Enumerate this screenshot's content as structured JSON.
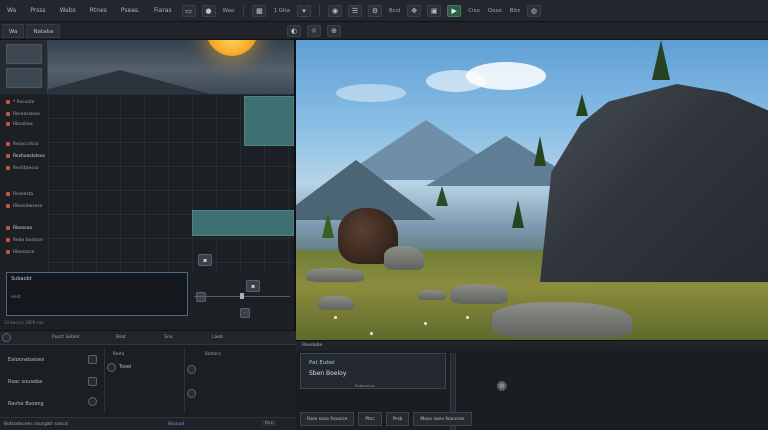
{
  "menubar": {
    "items": [
      "Wa",
      "Prsss",
      "Wabs",
      "Rtnes",
      "Pseas.",
      "Fiaras"
    ],
    "tb_label_1": "Wao",
    "tb_label_2": "1 Gtia",
    "tb_label_3": "Bcsl",
    "tb_label_4": "Ciso",
    "tb_label_5": "Ooso",
    "tb_label_6": "Bitz"
  },
  "toolbar2": {
    "tab1": "Wa",
    "tab2": "Nataba"
  },
  "left_panel": {
    "rows": [
      {
        "label": "* Rscusto",
        "hl": false
      },
      {
        "label": "Rbreaslasse",
        "hl": false
      },
      {
        "label": "Rbsaloac",
        "hl": false
      },
      {
        "label": "Relaccrlsco",
        "hl": false
      },
      {
        "label": "Reshoeslotsos",
        "hl": true
      },
      {
        "label": "Reshtaesso",
        "hl": false
      },
      {
        "label": "Reskesta",
        "hl": false
      },
      {
        "label": "Rbesotwseso",
        "hl": false
      },
      {
        "label": "Rbessoa",
        "hl": true
      },
      {
        "label": "Rebo bosloce",
        "hl": false
      },
      {
        "label": "Rbseasce",
        "hl": false
      }
    ],
    "curve_label": "Subaobt",
    "curve_value": "eest",
    "status": "10 boo:sa 1800 coo"
  },
  "bottom_left": {
    "headers": [
      "Pusct Sobler",
      "Bsot",
      "Sno",
      "Laeb"
    ],
    "rows": [
      "Eaioonebaloes",
      "Rsac souseba",
      "Ravhe Bsoeng"
    ],
    "col_labels": [
      "Resta",
      "Bostons"
    ],
    "col_value": "Tsoel",
    "footer_left": "Botsodocees sourgatr soocd",
    "footer_mid": "Bssoud",
    "footer_right": "Rcs"
  },
  "bottom_right": {
    "header": "Reeslobe",
    "card_title": "Pat Eubel",
    "card_sub": "Sben Boeloy",
    "card_foot": "Bsbossoan",
    "bar_btn1": "Rare ssoe fsoocse",
    "bar_btn2": "Ptsc",
    "bar_btn3": "Prsb",
    "bar_btn4": "Mosv soev fsaccses"
  }
}
